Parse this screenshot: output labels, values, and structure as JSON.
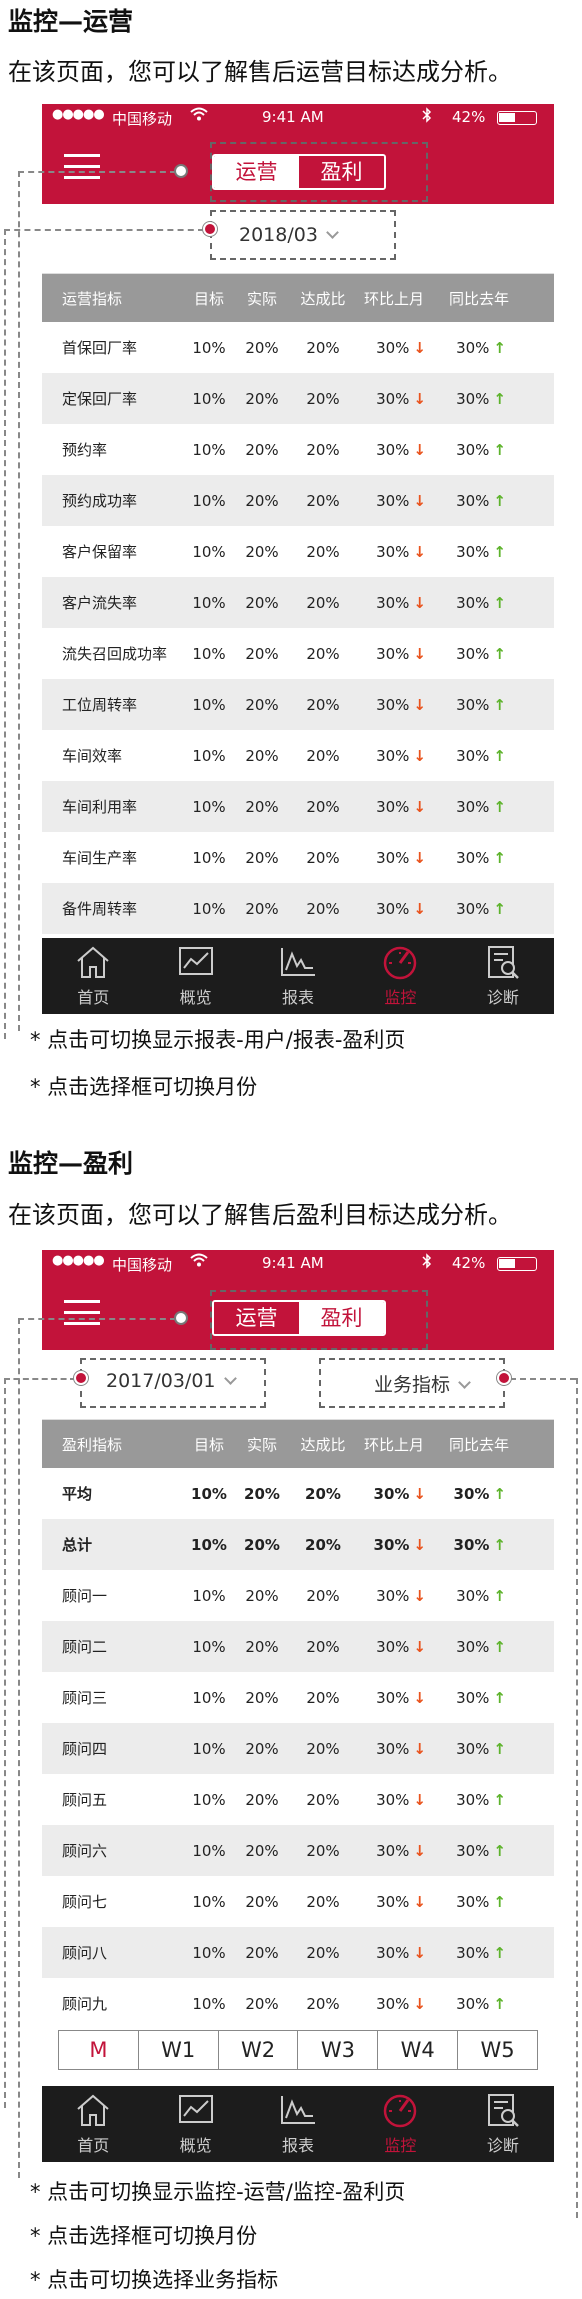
{
  "section1": {
    "title": "监控—运营",
    "desc": "在该页面，您可以了解售后运营目标达成分析。",
    "status": {
      "dots": "●●●●●",
      "carrier": "中国移动",
      "time": "9:41 AM",
      "battery": "42%"
    },
    "segment": {
      "left": "运营",
      "right": "盈利"
    },
    "filter": {
      "month": "2018/03"
    },
    "table": {
      "headers": [
        "运营指标",
        "目标",
        "实际",
        "达成比",
        "环比上月",
        "同比去年"
      ],
      "rows": [
        {
          "name": "首保回厂率",
          "target": "10%",
          "actual": "20%",
          "ratio": "20%",
          "mom": "30%",
          "yoy": "30%"
        },
        {
          "name": "定保回厂率",
          "target": "10%",
          "actual": "20%",
          "ratio": "20%",
          "mom": "30%",
          "yoy": "30%"
        },
        {
          "name": "预约率",
          "target": "10%",
          "actual": "20%",
          "ratio": "20%",
          "mom": "30%",
          "yoy": "30%"
        },
        {
          "name": "预约成功率",
          "target": "10%",
          "actual": "20%",
          "ratio": "20%",
          "mom": "30%",
          "yoy": "30%"
        },
        {
          "name": "客户保留率",
          "target": "10%",
          "actual": "20%",
          "ratio": "20%",
          "mom": "30%",
          "yoy": "30%"
        },
        {
          "name": "客户流失率",
          "target": "10%",
          "actual": "20%",
          "ratio": "20%",
          "mom": "30%",
          "yoy": "30%"
        },
        {
          "name": "流失召回成功率",
          "target": "10%",
          "actual": "20%",
          "ratio": "20%",
          "mom": "30%",
          "yoy": "30%"
        },
        {
          "name": "工位周转率",
          "target": "10%",
          "actual": "20%",
          "ratio": "20%",
          "mom": "30%",
          "yoy": "30%"
        },
        {
          "name": "车间效率",
          "target": "10%",
          "actual": "20%",
          "ratio": "20%",
          "mom": "30%",
          "yoy": "30%"
        },
        {
          "name": "车间利用率",
          "target": "10%",
          "actual": "20%",
          "ratio": "20%",
          "mom": "30%",
          "yoy": "30%"
        },
        {
          "name": "车间生产率",
          "target": "10%",
          "actual": "20%",
          "ratio": "20%",
          "mom": "30%",
          "yoy": "30%"
        },
        {
          "name": "备件周转率",
          "target": "10%",
          "actual": "20%",
          "ratio": "20%",
          "mom": "30%",
          "yoy": "30%"
        }
      ]
    },
    "notes": [
      "*  点击可切换显示报表-用户/报表-盈利页",
      "*  点击选择框可切换月份"
    ]
  },
  "section2": {
    "title": "监控—盈利",
    "desc": "在该页面，您可以了解售后盈利目标达成分析。",
    "status": {
      "dots": "●●●●●",
      "carrier": "中国移动",
      "time": "9:41 AM",
      "battery": "42%"
    },
    "segment": {
      "left": "运营",
      "right": "盈利"
    },
    "filter": {
      "date": "2017/03/01",
      "metric": "业务指标"
    },
    "table": {
      "headers": [
        "盈利指标",
        "目标",
        "实际",
        "达成比",
        "环比上月",
        "同比去年"
      ],
      "rows": [
        {
          "name": "平均",
          "target": "10%",
          "actual": "20%",
          "ratio": "20%",
          "mom": "30%",
          "yoy": "30%"
        },
        {
          "name": "总计",
          "target": "10%",
          "actual": "20%",
          "ratio": "20%",
          "mom": "30%",
          "yoy": "30%"
        },
        {
          "name": "顾问一",
          "target": "10%",
          "actual": "20%",
          "ratio": "20%",
          "mom": "30%",
          "yoy": "30%"
        },
        {
          "name": "顾问二",
          "target": "10%",
          "actual": "20%",
          "ratio": "20%",
          "mom": "30%",
          "yoy": "30%"
        },
        {
          "name": "顾问三",
          "target": "10%",
          "actual": "20%",
          "ratio": "20%",
          "mom": "30%",
          "yoy": "30%"
        },
        {
          "name": "顾问四",
          "target": "10%",
          "actual": "20%",
          "ratio": "20%",
          "mom": "30%",
          "yoy": "30%"
        },
        {
          "name": "顾问五",
          "target": "10%",
          "actual": "20%",
          "ratio": "20%",
          "mom": "30%",
          "yoy": "30%"
        },
        {
          "name": "顾问六",
          "target": "10%",
          "actual": "20%",
          "ratio": "20%",
          "mom": "30%",
          "yoy": "30%"
        },
        {
          "name": "顾问七",
          "target": "10%",
          "actual": "20%",
          "ratio": "20%",
          "mom": "30%",
          "yoy": "30%"
        },
        {
          "name": "顾问八",
          "target": "10%",
          "actual": "20%",
          "ratio": "20%",
          "mom": "30%",
          "yoy": "30%"
        },
        {
          "name": "顾问九",
          "target": "10%",
          "actual": "20%",
          "ratio": "20%",
          "mom": "30%",
          "yoy": "30%"
        }
      ]
    },
    "weeks": [
      "M",
      "W1",
      "W2",
      "W3",
      "W4",
      "W5"
    ],
    "notes": [
      "*  点击可切换显示监控-运营/监控-盈利页",
      "*  点击选择框可切换月份",
      "*  点击可切换选择业务指标"
    ]
  },
  "tabs": [
    {
      "label": "首页",
      "icon": "home-icon"
    },
    {
      "label": "概览",
      "icon": "chart-icon"
    },
    {
      "label": "报表",
      "icon": "report-icon"
    },
    {
      "label": "监控",
      "icon": "gauge-icon"
    },
    {
      "label": "诊断",
      "icon": "diagnosis-icon"
    }
  ],
  "colors": {
    "brand": "#c2133a",
    "up": "#5db32b",
    "down": "#e9531d"
  }
}
